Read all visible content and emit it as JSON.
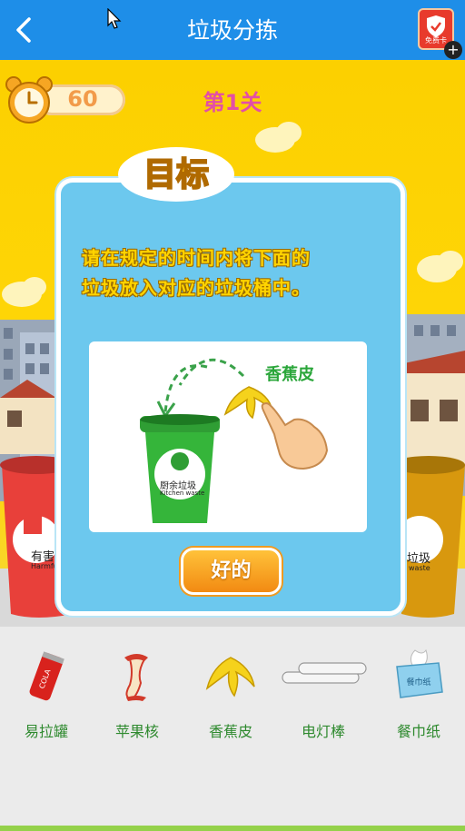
{
  "header": {
    "title": "垃圾分拣",
    "free_card_label": "免费卡",
    "plus": "+"
  },
  "hud": {
    "timer_value": "60",
    "level": "第1关"
  },
  "bins": {
    "left_label_cn": "有害",
    "left_label_en": "Harmful",
    "right_label_cn": "垃圾",
    "right_label_en": "waste"
  },
  "dialog": {
    "title": "目标",
    "instruction_line1": "请在规定的时间内将下面的",
    "instruction_line2": "垃圾放入对应的垃圾桶中。",
    "item_label": "香蕉皮",
    "bin_label_cn": "厨余垃圾",
    "bin_label_en": "Kitchen waste",
    "ok_button": "好的"
  },
  "items": [
    {
      "label": "易拉罐",
      "icon": "soda-can-icon"
    },
    {
      "label": "苹果核",
      "icon": "apple-core-icon"
    },
    {
      "label": "香蕉皮",
      "icon": "banana-peel-icon"
    },
    {
      "label": "电灯棒",
      "icon": "fluorescent-tube-icon"
    },
    {
      "label": "餐巾纸",
      "icon": "tissue-box-icon"
    }
  ],
  "item_text": {
    "can_brand": "COLA",
    "tissue_box": "餐巾纸"
  },
  "colors": {
    "topbar": "#1e8ee8",
    "scene_background": "#fcd000",
    "dialog_background": "#6cc8ee",
    "level_text": "#e34ea7",
    "ok_button": "#f7a21c",
    "kitchen_bin": "#35b53a",
    "harmful_bin": "#e8403a",
    "other_bin": "#d8980e"
  }
}
